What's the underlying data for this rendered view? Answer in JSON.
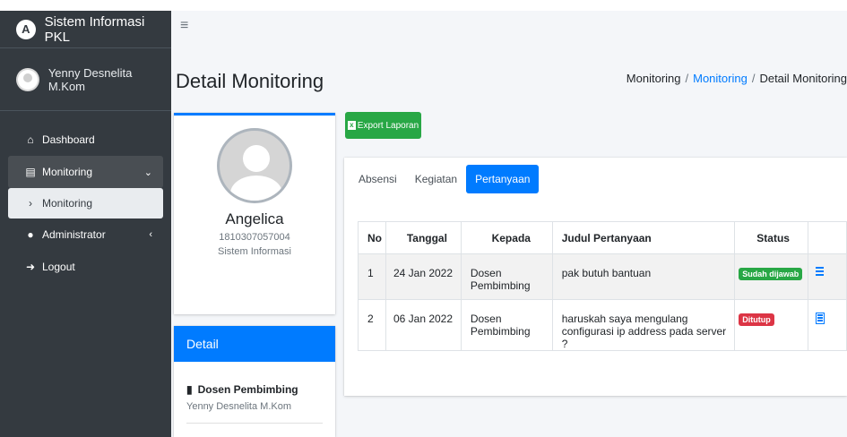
{
  "app": {
    "title": "Sistem Informasi PKL",
    "logo_letter": "A"
  },
  "user": {
    "name": "Yenny Desnelita M.Kom"
  },
  "sidebar": {
    "items": [
      {
        "label": "Dashboard",
        "icon": "home-icon"
      },
      {
        "label": "Monitoring",
        "icon": "chart-area-icon"
      },
      {
        "label": "Monitoring",
        "icon": "chevron-right-icon"
      },
      {
        "label": "Administrator",
        "icon": "user-icon"
      },
      {
        "label": "Logout",
        "icon": "sign-out-icon"
      }
    ]
  },
  "header": {
    "page_title": "Detail Monitoring",
    "breadcrumb": [
      "Monitoring",
      "Monitoring",
      "Detail Monitoring"
    ],
    "breadcrumb_sep": "/"
  },
  "profile": {
    "name": "Angelica",
    "nim": "1810307057004",
    "prodi": "Sistem Informasi"
  },
  "detail": {
    "header": "Detail",
    "label": "Dosen Pembimbing",
    "value": "Yenny Desnelita M.Kom"
  },
  "toolbar": {
    "export_label": "Export Laporan"
  },
  "tabs": [
    {
      "label": "Absensi"
    },
    {
      "label": "Kegiatan"
    },
    {
      "label": "Pertanyaan"
    }
  ],
  "table": {
    "headers": [
      "No",
      "Tanggal",
      "Kepada",
      "Judul Pertanyaan",
      "Status"
    ],
    "rows": [
      {
        "no": "1",
        "tanggal": "24 Jan 2022",
        "kepada": "Dosen Pembimbing",
        "judul": "pak butuh bantuan",
        "status": "Sudah dijawab"
      },
      {
        "no": "2",
        "tanggal": "06 Jan 2022",
        "kepada": "Dosen Pembimbing",
        "judul": "haruskah saya mengulang configurasi ip address pada server ?",
        "status": "Ditutup"
      }
    ]
  },
  "colors": {
    "sidebar_bg": "#343a40",
    "primary": "#007bff",
    "success": "#28a745",
    "danger": "#dc3545"
  }
}
